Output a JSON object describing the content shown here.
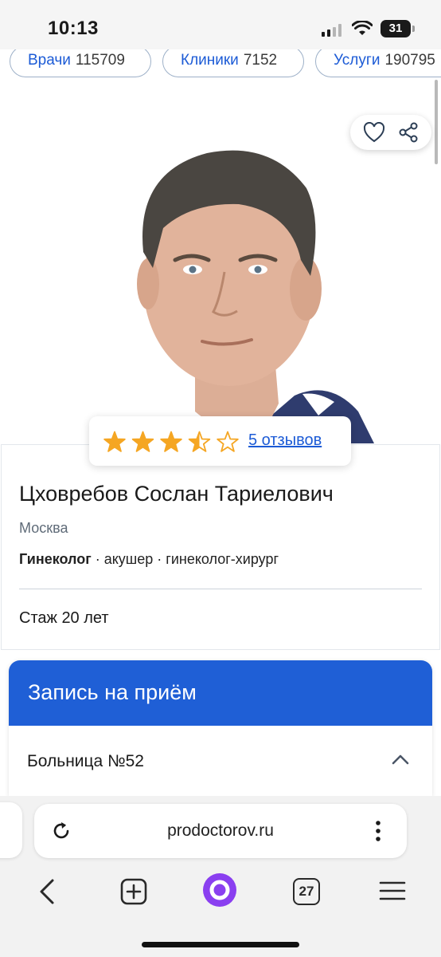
{
  "status_bar": {
    "time": "10:13",
    "battery": "31"
  },
  "chips": [
    {
      "label": "Врачи",
      "count": "115709"
    },
    {
      "label": "Клиники",
      "count": "7152"
    },
    {
      "label": "Услуги",
      "count": "190795"
    }
  ],
  "rating": {
    "stars": 3.5,
    "max": 5,
    "reviews": "5 отзывов",
    "color": "#f5a623"
  },
  "doctor": {
    "name": "Цховребов Сослан Тариелович",
    "city": "Москва",
    "specialty_main": "Гинеколог",
    "specialty_rest": " · акушер · гинеколог-хирург",
    "experience": "Стаж 20 лет"
  },
  "appointment": {
    "title": "Запись на приём",
    "clinic": "Больница №52",
    "accent": "#1f5fd6"
  },
  "browser": {
    "url": "prodoctorov.ru",
    "tabs_count": "27"
  },
  "icons": {
    "favorite": "heart-icon",
    "share": "share-icon",
    "reload": "reload-icon",
    "more": "kebab-icon",
    "back": "chevron-left-icon",
    "new_tab": "plus-square-icon",
    "assistant": "alice-icon",
    "menu": "hamburger-icon"
  }
}
